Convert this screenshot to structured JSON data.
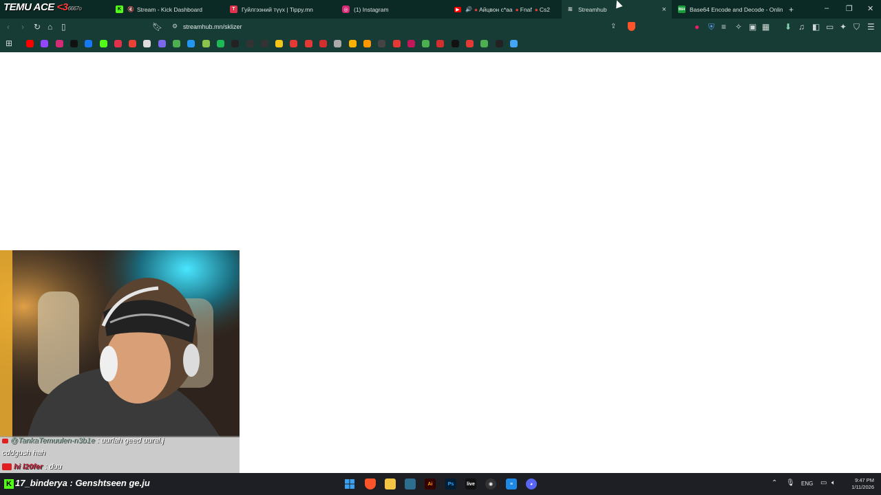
{
  "overlay": {
    "title_left": "TEMU ACE ",
    "title_red": "<3",
    "title_sub": "6667",
    "title_tail": "o"
  },
  "tabs": [
    {
      "label": "Stream - Kick Dashboard",
      "favicon": "kick-icon",
      "color": "#53fc18",
      "muted": true
    },
    {
      "label": "Гуйлгээний түүх | Tippy.mn",
      "favicon": "tippy-icon",
      "color": "#e2314a"
    },
    {
      "label": "(1) Instagram",
      "favicon": "instagram-icon",
      "color": "#d62976"
    },
    {
      "label": "Айцвон с*аа",
      "extra1": "Fnaf",
      "extra2": "Cs2",
      "favicon": "youtube-icon",
      "color": "#ff0000"
    },
    {
      "label": "Streamhub",
      "favicon": "streamhub-icon",
      "color": "#e4e4e4",
      "active": true
    },
    {
      "label": "Base64 Encode and Decode - Online",
      "favicon": "base64-icon",
      "color": "#1b9b3c"
    }
  ],
  "tab_controls": {
    "new_tab": "+",
    "close": "×",
    "minimize": "–",
    "restore": "❐",
    "close_window": "✕"
  },
  "address_bar": {
    "url": "streamhub.mn/sklizer"
  },
  "bookmarks": [
    {
      "icon": "youtube-icon",
      "color": "#ff0000"
    },
    {
      "icon": "twitch-icon",
      "color": "#9146ff"
    },
    {
      "icon": "instagram-icon",
      "color": "#d62976"
    },
    {
      "icon": "tiktok-icon",
      "color": "#111111"
    },
    {
      "icon": "facebook-icon",
      "color": "#1877f2"
    },
    {
      "icon": "kick-icon",
      "color": "#53fc18"
    },
    {
      "icon": "tippy-icon",
      "color": "#e2314a"
    },
    {
      "icon": "gmail-icon",
      "color": "#ea4335"
    },
    {
      "icon": "diamond-icon",
      "color": "#dddddd"
    },
    {
      "icon": "v-icon",
      "color": "#7b68ee"
    },
    {
      "icon": "download-icon",
      "color": "#4caf50"
    },
    {
      "icon": "check-icon",
      "color": "#2196f3"
    },
    {
      "icon": "stream-icon",
      "color": "#8bc34a"
    },
    {
      "icon": "spotify-like-icon",
      "color": "#1db954"
    },
    {
      "icon": "film-icon",
      "color": "#222222"
    },
    {
      "icon": "circle-icon",
      "color": "#333333"
    },
    {
      "icon": "google-icon",
      "color": "#333333"
    },
    {
      "icon": "skull-icon",
      "color": "#f5c518"
    },
    {
      "icon": "heart-icon",
      "color": "#e53935"
    },
    {
      "icon": "x-icon",
      "color": "#e53935"
    },
    {
      "icon": "box-icon",
      "color": "#d32f2f"
    },
    {
      "icon": "globe-icon",
      "color": "#aaaaaa"
    },
    {
      "icon": "coin-icon",
      "color": "#ffb300"
    },
    {
      "icon": "orange-icon",
      "color": "#ff9800"
    },
    {
      "icon": "glasses-icon",
      "color": "#444444"
    },
    {
      "icon": "dot-icon",
      "color": "#e53935"
    },
    {
      "icon": "w-icon",
      "color": "#c2185b"
    },
    {
      "icon": "g-icon",
      "color": "#4caf50"
    },
    {
      "icon": "r-icon",
      "color": "#d32f2f"
    },
    {
      "icon": "c-icon",
      "color": "#111111"
    },
    {
      "icon": "grid-icon",
      "color": "#e53935"
    },
    {
      "icon": "green-dot-icon",
      "color": "#4caf50"
    },
    {
      "icon": "dark-circle-icon",
      "color": "#222222"
    },
    {
      "icon": "sparkle-icon",
      "color": "#42a5f5"
    }
  ],
  "chat": {
    "line1_name": "@TankaTemuulen-n3b1e",
    "line1_msg": " : uurlah geed uural.j",
    "line2": "cddgush hah",
    "line3_name": "hi l20",
    "line3_suffix": "fer",
    "line3_msg": " : duu"
  },
  "kick_bar": {
    "count": "17",
    "user": "_binderya",
    "msg": " : Genshtseen ge.ju"
  },
  "tray": {
    "lang": "ENG",
    "time": "9:47 PM",
    "date": "1/11/2026"
  }
}
